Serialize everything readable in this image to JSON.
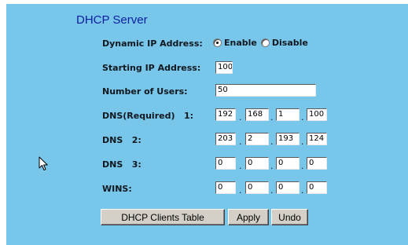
{
  "section_title": "DHCP Server",
  "dynamic_ip": {
    "label": "Dynamic IP Address:",
    "options": [
      "Enable",
      "Disable"
    ],
    "selected": "Enable"
  },
  "starting_ip": {
    "label": "Starting IP Address:",
    "value": "100"
  },
  "num_users": {
    "label": "Number of Users:",
    "value": "50"
  },
  "dns_required": {
    "label": "DNS(Required)   1:",
    "octets": [
      "192",
      "168",
      "1",
      "100"
    ]
  },
  "dns2": {
    "label": "DNS   2:",
    "octets": [
      "203",
      "2",
      "193",
      "124"
    ]
  },
  "dns3": {
    "label": "DNS   3:",
    "octets": [
      "0",
      "0",
      "0",
      "0"
    ]
  },
  "wins": {
    "label": "WINS:",
    "octets": [
      "0",
      "0",
      "0",
      "0"
    ]
  },
  "buttons": {
    "clients_table": "DHCP Clients Table",
    "apply": "Apply",
    "undo": "Undo"
  },
  "colors": {
    "panel_bg": "#78c6ea",
    "title": "#0a1fa0",
    "button_face": "#d4d0c8"
  },
  "icons": {
    "cursor": "mouse-pointer-icon"
  }
}
